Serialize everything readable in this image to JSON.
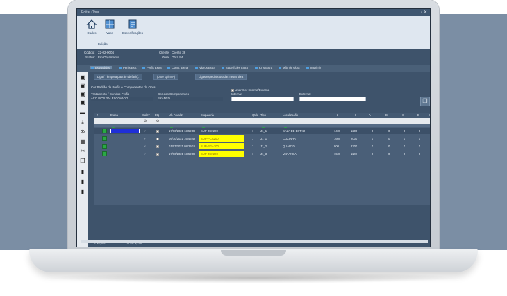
{
  "window": {
    "title": "Editar Obra",
    "controls": "▫ ✕"
  },
  "ribbon": {
    "buttons": [
      {
        "label": "Dados",
        "icon": "home-icon"
      },
      {
        "label": "Vaos",
        "icon": "window-icon"
      },
      {
        "label": "Especificações",
        "icon": "spec-icon"
      }
    ],
    "group_label": "Edição"
  },
  "info": {
    "codigo_label": "Código:",
    "codigo_value": "22-02-0004",
    "status_label": "Status:",
    "status_value": "Em Orçamento",
    "cliente_label": "Cliente:",
    "cliente_value": "Cliente 36",
    "obra_label": "Obra:",
    "obra_value": "Obra 94"
  },
  "tabs": [
    {
      "label": "Esquadrias",
      "active": true
    },
    {
      "label": "Perfis Esp.",
      "active": false
    },
    {
      "label": "Perfis Extra",
      "active": false
    },
    {
      "label": "Comp. Extra",
      "active": false
    },
    {
      "label": "Vidros Extra",
      "active": false
    },
    {
      "label": "Superfícies Extra",
      "active": false
    },
    {
      "label": "KITs Extra",
      "active": false
    },
    {
      "label": "Mão de Obra",
      "active": false
    },
    {
      "label": "Imprimir",
      "active": false
    }
  ],
  "toolbar": {
    "liga_label": "Liga / Têmpera padrão (default):",
    "peso_label": "(0,00 kg/mm²)",
    "ligas_especiais": "Ligas especiais usadas nesta obra"
  },
  "colors_section": {
    "title": "Cor Padrão de Perfis e Componentes da Obra:",
    "tratamento_label": "Tratamento / Cor dos Perfis",
    "tratamento_value": "AÇO INOX 304 ESCOVADO",
    "componentes_label": "Cor dos Componentes",
    "componentes_value": "BRANCO",
    "usar_cor_label": "Usar Cor Interna/Externa",
    "interna_label": "Interna:",
    "externa_label": "Externa:"
  },
  "grid": {
    "columns": [
      "#",
      "",
      "Etapa",
      "Calc?",
      "Etq",
      "Ult. Atualiz.",
      "Esquadria",
      "Qtde",
      "Tipo",
      "Localização",
      "L",
      "H",
      "A",
      "B",
      "C",
      "D",
      "E"
    ],
    "rows": [
      {
        "num": "",
        "date": "17/06/2021 13:52:08",
        "esquadria": "SUP-JCX200",
        "qtde": "1",
        "tipo": "J1_1",
        "local": "SALA DE ESTAR",
        "L": "1400",
        "H": "1200",
        "A": "0",
        "B": "0",
        "C": "0",
        "D": "0",
        "yellow": false,
        "selected": true
      },
      {
        "num": "",
        "date": "05/10/2021 16:46:42",
        "esquadria": "SUP-PCA200",
        "qtde": "1",
        "tipo": "J1_1",
        "local": "COZINHA",
        "L": "1600",
        "H": "2000",
        "A": "0",
        "B": "0",
        "C": "0",
        "D": "0",
        "yellow": true,
        "selected": false
      },
      {
        "num": "",
        "date": "01/07/2021 08:29:15",
        "esquadria": "SUP-PGA100",
        "qtde": "1",
        "tipo": "J1_2",
        "local": "QUARTO",
        "L": "900",
        "H": "2200",
        "A": "0",
        "B": "0",
        "C": "0",
        "D": "0",
        "yellow": true,
        "selected": false
      },
      {
        "num": "",
        "date": "17/06/2021 13:52:08",
        "esquadria": "SUP-JCX200",
        "qtde": "1",
        "tipo": "J1_3",
        "local": "VARANDA",
        "L": "1500",
        "H": "1100",
        "A": "0",
        "B": "0",
        "C": "0",
        "D": "0",
        "yellow": true,
        "selected": false
      }
    ]
  },
  "footer": {
    "left": "J: 10,000",
    "right": "M ×6: 4,795"
  },
  "colors": {
    "accent": "#4f9fe0",
    "highlight": "#ffff00",
    "green": "#2aa845"
  }
}
